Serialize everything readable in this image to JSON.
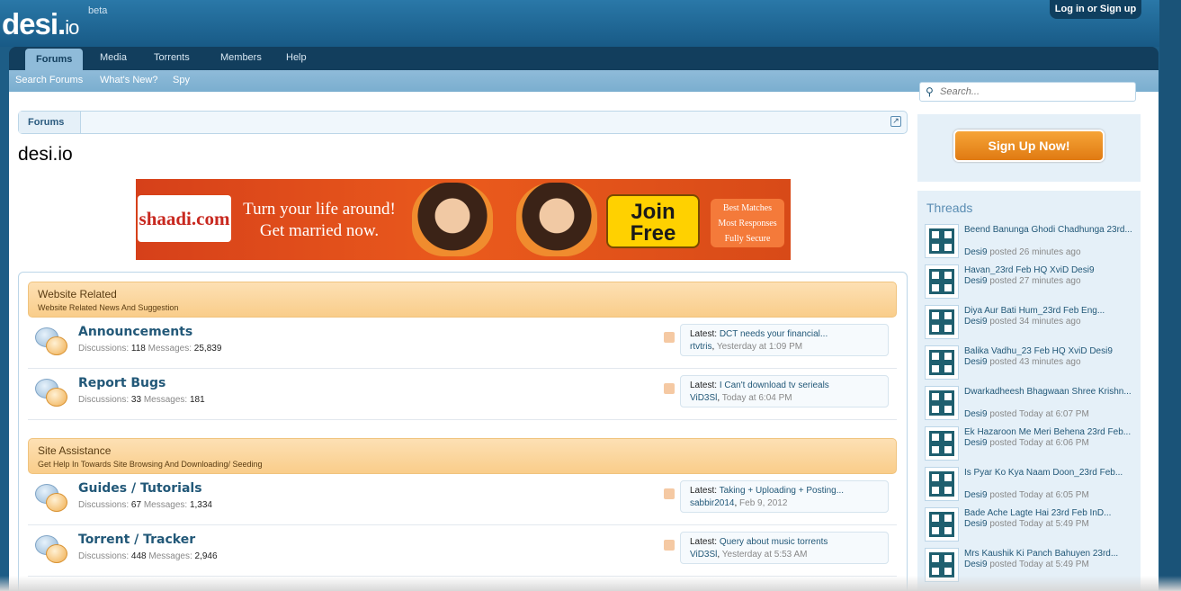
{
  "header": {
    "logo_main": "desi",
    "logo_dot": ".",
    "logo_tld": "io",
    "beta": "beta",
    "login": "Log in or Sign up"
  },
  "nav": {
    "tabs": [
      "Forums",
      "Media",
      "Torrents",
      "Members",
      "Help"
    ],
    "active": "Forums"
  },
  "subnav": [
    "Search Forums",
    "What's New?",
    "Spy"
  ],
  "breadcrumb": {
    "item": "Forums"
  },
  "page_title": "desi.io",
  "banner": {
    "brand": "shaadi.com",
    "tagline_line1": "Turn your life around!",
    "tagline_line2": "Get married now.",
    "join_line1": "Join",
    "join_line2": "Free",
    "perk1": "Best Matches",
    "perk2": "Most Responses",
    "perk3": "Fully Secure"
  },
  "categories": [
    {
      "title": "Website Related",
      "desc": "Website Related News And Suggestion",
      "forums": [
        {
          "name": "Announcements",
          "disc_label": "Discussions:",
          "disc": "118",
          "msg_label": "Messages:",
          "msgs": "25,839",
          "latest_label": "Latest:",
          "latest_title": "DCT needs your financial...",
          "latest_user": "rtvtris",
          "latest_date": "Yesterday at 1:09 PM"
        },
        {
          "name": "Report Bugs",
          "disc_label": "Discussions:",
          "disc": "33",
          "msg_label": "Messages:",
          "msgs": "181",
          "latest_label": "Latest:",
          "latest_title": "I Can't download tv serieals",
          "latest_user": "ViD3Sl",
          "latest_date": "Today at 6:04 PM"
        }
      ]
    },
    {
      "title": "Site Assistance",
      "desc": "Get Help In Towards Site Browsing And Downloading/ Seeding",
      "forums": [
        {
          "name": "Guides / Tutorials",
          "disc_label": "Discussions:",
          "disc": "67",
          "msg_label": "Messages:",
          "msgs": "1,334",
          "latest_label": "Latest:",
          "latest_title": "Taking + Uploading + Posting...",
          "latest_user": "sabbir2014",
          "latest_date": "Feb 9, 2012"
        },
        {
          "name": "Torrent / Tracker",
          "disc_label": "Discussions:",
          "disc": "448",
          "msg_label": "Messages:",
          "msgs": "2,946",
          "latest_label": "Latest:",
          "latest_title": "Query about music torrents",
          "latest_user": "ViD3Sl",
          "latest_date": "Yesterday at 5:53 AM"
        }
      ]
    }
  ],
  "sidebar": {
    "search_placeholder": "Search...",
    "signup": "Sign Up Now!",
    "threads_heading": "Threads",
    "threads": [
      {
        "title": "Beend Banunga Ghodi Chadhunga 23rd...",
        "user": "Desi9",
        "posted": "posted 26 minutes ago"
      },
      {
        "title": "Havan_23rd Feb HQ XviD Desi9",
        "user": "Desi9",
        "posted": "posted 27 minutes ago"
      },
      {
        "title": "Diya Aur Bati Hum_23rd Feb Eng...",
        "user": "Desi9",
        "posted": "posted 34 minutes ago"
      },
      {
        "title": "Balika Vadhu_23 Feb HQ XviD Desi9",
        "user": "Desi9",
        "posted": "posted 43 minutes ago"
      },
      {
        "title": "Dwarkadheesh Bhagwaan Shree Krishn...",
        "user": "Desi9",
        "posted": "posted Today at 6:07 PM"
      },
      {
        "title": "Ek Hazaroon Me Meri Behena 23rd Feb...",
        "user": "Desi9",
        "posted": "posted Today at 6:06 PM"
      },
      {
        "title": "Is Pyar Ko Kya Naam Doon_23rd Feb...",
        "user": "Desi9",
        "posted": "posted Today at 6:05 PM"
      },
      {
        "title": "Bade Ache Lagte Hai 23rd Feb InD...",
        "user": "Desi9",
        "posted": "posted Today at 5:49 PM"
      },
      {
        "title": "Mrs Kaushik Ki Panch Bahuyen 23rd...",
        "user": "Desi9",
        "posted": "posted Today at 5:49 PM"
      }
    ]
  },
  "colors": {
    "nav_dark": "#123e5d",
    "accent": "#225878",
    "signup_orange": "#e07a12",
    "category_bg": "#fde0b4"
  }
}
